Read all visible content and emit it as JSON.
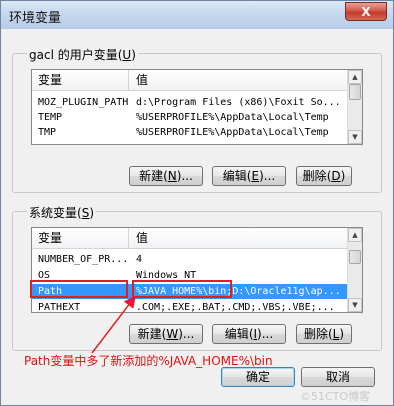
{
  "window": {
    "title": "环境变量",
    "close_label": "X"
  },
  "user_vars": {
    "label": "gacl 的用户变量",
    "accel": "U",
    "columns": [
      "变量",
      "值"
    ],
    "rows": [
      {
        "name": "MOZ_PLUGIN_PATH",
        "value": "d:\\Program Files (x86)\\Foxit So..."
      },
      {
        "name": "TEMP",
        "value": "%USERPROFILE%\\AppData\\Local\\Temp"
      },
      {
        "name": "TMP",
        "value": "%USERPROFILE%\\AppData\\Local\\Temp"
      }
    ],
    "buttons": {
      "new": {
        "label": "新建",
        "accel": "N",
        "suffix": "..."
      },
      "edit": {
        "label": "编辑",
        "accel": "E",
        "suffix": "..."
      },
      "delete": {
        "label": "删除",
        "accel": "D",
        "suffix": ""
      }
    }
  },
  "system_vars": {
    "label": "系统变量",
    "accel": "S",
    "columns": [
      "变量",
      "值"
    ],
    "rows": [
      {
        "name": "NUMBER_OF_PR...",
        "value": "4"
      },
      {
        "name": "OS",
        "value": "Windows_NT"
      },
      {
        "name": "Path",
        "value": "%JAVA_HOME%\\bin;D:\\Oracle11g\\ap...",
        "selected": true
      },
      {
        "name": "PATHEXT",
        "value": ".COM;.EXE;.BAT;.CMD;.VBS;.VBE;..."
      }
    ],
    "buttons": {
      "new": {
        "label": "新建",
        "accel": "W",
        "suffix": "..."
      },
      "edit": {
        "label": "编辑",
        "accel": "I",
        "suffix": "..."
      },
      "delete": {
        "label": "删除",
        "accel": "L",
        "suffix": ""
      }
    }
  },
  "footer": {
    "ok": "确定",
    "cancel": "取消"
  },
  "annotation": {
    "text": "Path变量中多了新添加的%JAVA_HOME%\\bin",
    "color": "#e01010"
  },
  "watermark": "©51CTO博客",
  "colors": {
    "selection": "#3399ff",
    "annotation": "#e02020"
  }
}
